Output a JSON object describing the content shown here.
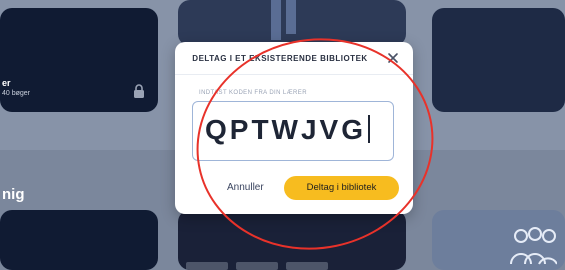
{
  "background": {
    "top_left_card": {
      "line1": "er",
      "line2": "40 bøger"
    },
    "section_title": "nig"
  },
  "dialog": {
    "title": "DELTAG I ET EKSISTERENDE BIBLIOTEK",
    "input_label": "INDTAST KODEN FRA DIN LÆRER",
    "code_value": "QPTWJVG",
    "cancel_label": "Annuller",
    "join_label": "Deltag i bibliotek"
  },
  "colors": {
    "accent_button": "#f7bc1f",
    "annotation": "#e8322a"
  },
  "icons": [
    "lock-icon",
    "close-icon",
    "people-icon"
  ]
}
